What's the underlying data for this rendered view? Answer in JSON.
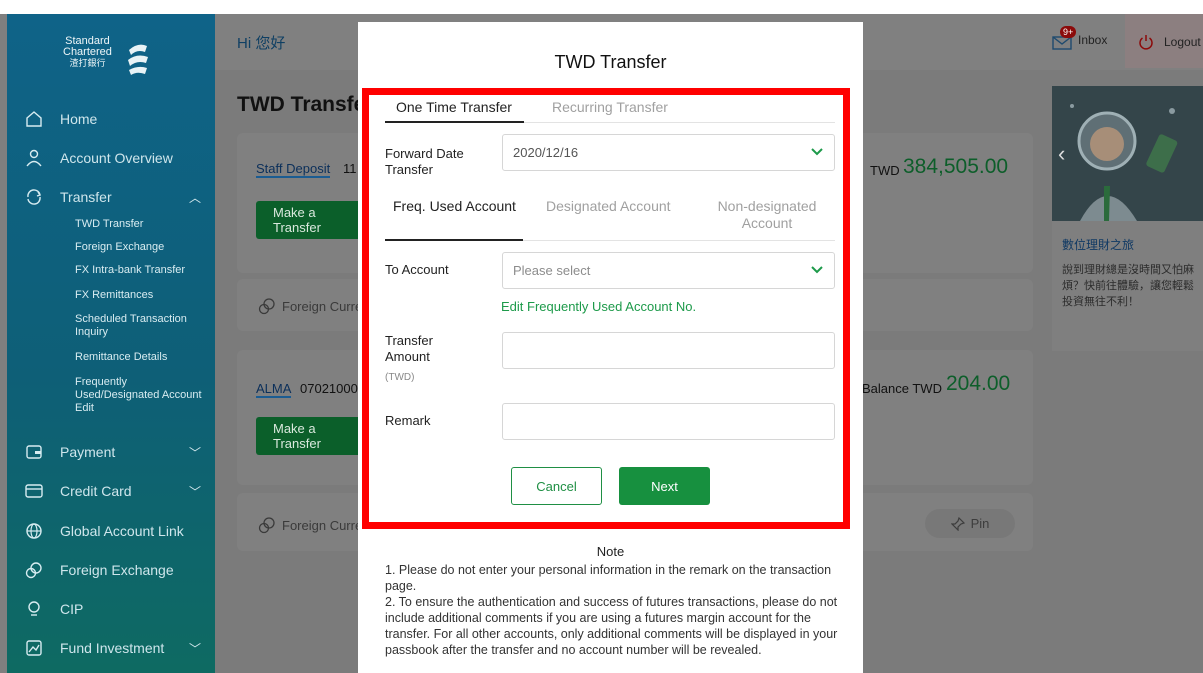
{
  "brand": {
    "line1": "Standard",
    "line2": "Chartered",
    "line3": "渣打銀行"
  },
  "sidebar": {
    "items": [
      {
        "label": "Home",
        "icon": "home-icon"
      },
      {
        "label": "Account Overview",
        "icon": "user-icon"
      },
      {
        "label": "Transfer",
        "icon": "transfer-icon",
        "expanded": true
      },
      {
        "label": "Payment",
        "icon": "wallet-icon"
      },
      {
        "label": "Credit Card",
        "icon": "credit-card-icon"
      },
      {
        "label": "Global Account Link",
        "icon": "globe-icon"
      },
      {
        "label": "Foreign Exchange",
        "icon": "coins-icon"
      },
      {
        "label": "CIP",
        "icon": "bulb-icon"
      },
      {
        "label": "Fund Investment",
        "icon": "chart-icon"
      }
    ],
    "transfer_sub": [
      "TWD Transfer",
      "Foreign Exchange",
      "FX Intra-bank Transfer",
      "FX Remittances",
      "Scheduled Transaction Inquiry",
      "Remittance Details",
      "Frequently Used/Designated Account Edit"
    ]
  },
  "header": {
    "greeting": "Hi 您好",
    "inbox_label": "Inbox",
    "inbox_badge": "9+",
    "logout_label": "Logout"
  },
  "page": {
    "title": "TWD Transfer"
  },
  "accounts": [
    {
      "name": "Staff Deposit",
      "number_fragment": "11",
      "balance_label": "TWD",
      "balance": "384,505.00",
      "button": "Make a Transfer",
      "fx_link": "Foreign Currency"
    },
    {
      "name": "ALMA",
      "number_fragment": "07021000",
      "balance_label": "Balance TWD",
      "balance": "204.00",
      "button": "Make a Transfer",
      "fx_link": "Foreign Currency"
    }
  ],
  "pin_label": "Pin",
  "promo": {
    "title": "數位理財之旅",
    "text": "說到理財總是沒時間又怕麻煩？快前往體驗，讓您輕鬆投資無往不利！"
  },
  "modal": {
    "title": "TWD Transfer",
    "tabs": [
      "One Time Transfer",
      "Recurring Transfer"
    ],
    "forward_date_label": "Forward Date Transfer",
    "forward_date_value": "2020/12/16",
    "account_tabs": [
      "Freq. Used Account",
      "Designated Account",
      "Non-designated Account"
    ],
    "to_account_label": "To Account",
    "to_account_placeholder": "Please select",
    "edit_link": "Edit Frequently Used Account No.",
    "amount_label": "Transfer Amount",
    "amount_unit": "(TWD)",
    "amount_value": "",
    "remark_label": "Remark",
    "remark_value": "",
    "cancel_label": "Cancel",
    "next_label": "Next",
    "note_title": "Note",
    "note_text": "1. Please do not enter your personal information in the remark on the transaction page.\n2. To ensure the authentication and success of futures transactions, please do not include additional comments if you are using a futures margin account for the transfer. For all other accounts, only additional comments will be displayed in your passbook after the transfer and no account number will be revealed."
  },
  "colors": {
    "highlight": "#ff0000",
    "accent_green": "#17903f",
    "sidebar": "#0f6388"
  }
}
